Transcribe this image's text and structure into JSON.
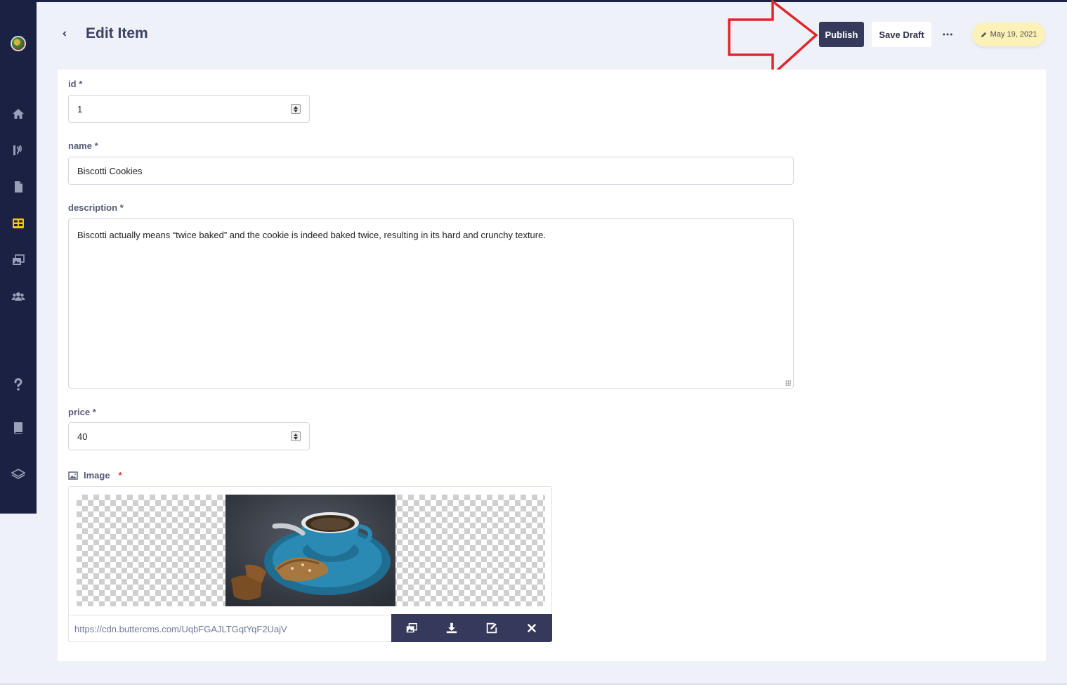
{
  "header": {
    "title": "Edit Item",
    "publish_label": "Publish",
    "save_draft_label": "Save Draft",
    "date_label": "May 19, 2021"
  },
  "sidebar": {
    "items": [
      {
        "name": "home",
        "icon": "home-icon",
        "active": false
      },
      {
        "name": "blog",
        "icon": "blog-icon",
        "active": false
      },
      {
        "name": "pages",
        "icon": "page-icon",
        "active": false
      },
      {
        "name": "collections",
        "icon": "table-icon",
        "active": true
      },
      {
        "name": "media",
        "icon": "media-icon",
        "active": false
      },
      {
        "name": "users",
        "icon": "users-icon",
        "active": false
      },
      {
        "name": "help",
        "icon": "help-icon",
        "active": false
      },
      {
        "name": "docs",
        "icon": "book-icon",
        "active": false
      },
      {
        "name": "layers",
        "icon": "layers-icon",
        "active": false
      }
    ],
    "accent": "#f5c518",
    "background": "#1b2142"
  },
  "form": {
    "id": {
      "label": "id",
      "required": "*",
      "value": "1"
    },
    "name": {
      "label": "name",
      "required": "*",
      "value": "Biscotti Cookies"
    },
    "description": {
      "label": "description",
      "required": "*",
      "value": "Biscotti actually means “twice baked” and the cookie is indeed baked twice, resulting in its hard and crunchy texture."
    },
    "price": {
      "label": "price",
      "required": "*",
      "value": "40"
    },
    "image": {
      "label": "Image",
      "required": "*",
      "url": "https://cdn.buttercms.com/UqbFGAJLTGqtYqF2UajV"
    }
  },
  "colors": {
    "primary_button": "#353a5c",
    "date_badge": "#fcf2b8",
    "annotation_arrow": "#e0262b",
    "background": "#eef1f8"
  }
}
